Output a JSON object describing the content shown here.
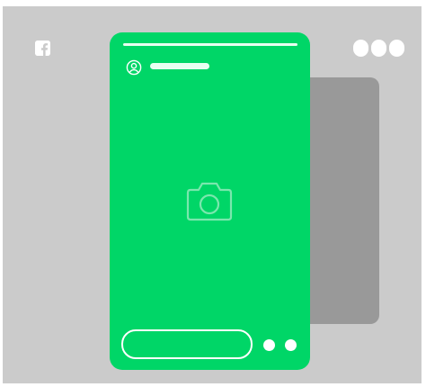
{
  "app": {
    "logo_icon": "facebook-icon",
    "menu_icon": "more-options-icon"
  },
  "story": {
    "progress": 1.0,
    "avatar_icon": "user-circle-icon",
    "media_icon": "camera-icon",
    "actions": [
      "dot-button",
      "dot-button"
    ]
  },
  "colors": {
    "frame_background": "#cbcbcb",
    "story_card": "#00d667",
    "next_story_card": "#999999",
    "overlay_light": "#e8fff1",
    "camera_outline": "#7ae7ad",
    "white": "#ffffff"
  }
}
